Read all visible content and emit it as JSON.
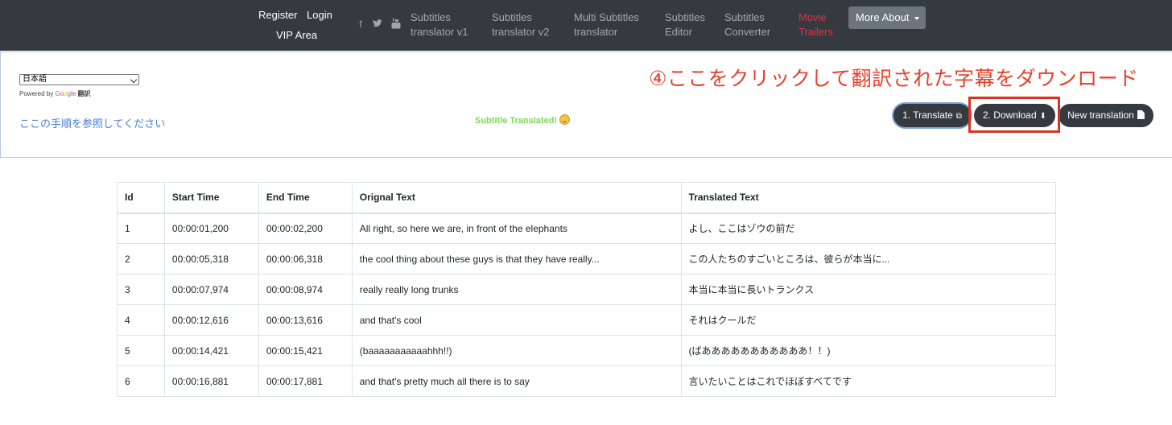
{
  "nav": {
    "register": "Register",
    "login": "Login",
    "vip": "VIP Area",
    "social": [
      "facebook-icon",
      "twitter-icon",
      "youtube-icon"
    ],
    "items": [
      {
        "line1": "Subtitles",
        "line2": "translator v1"
      },
      {
        "line1": "Subtitles",
        "line2": "translator v2"
      },
      {
        "line1": "Multi Subtitles",
        "line2": "translator"
      },
      {
        "line1": "Subtitles",
        "line2": "Editor"
      },
      {
        "line1": "Subtitles",
        "line2": "Converter"
      },
      {
        "line1": "Movie",
        "line2": "Trailers"
      }
    ],
    "more_about": "More About",
    "accent_red": "#dc3545"
  },
  "translate_widget": {
    "selected_language": "日本語",
    "powered_by": "Powered by",
    "google": [
      "G",
      "o",
      "o",
      "g",
      "l",
      "e"
    ],
    "translate_word": "翻訳"
  },
  "annotation": "④ここをクリックして翻訳された字幕をダウンロード",
  "help_link": "ここの手順を参照してください",
  "status": "Subtitle Translated!",
  "buttons": {
    "translate": "1. Translate",
    "download": "2. Download",
    "new_translation": "New translation"
  },
  "table": {
    "headers": [
      "Id",
      "Start Time",
      "End Time",
      "Orignal Text",
      "Translated Text"
    ],
    "rows": [
      [
        "1",
        "00:00:01,200",
        "00:00:02,200",
        "All right, so here we are, in front of the elephants",
        "よし、ここはゾウの前だ"
      ],
      [
        "2",
        "00:00:05,318",
        "00:00:06,318",
        "the cool thing about these guys is that they have really...",
        "この人たちのすごいところは、彼らが本当に..."
      ],
      [
        "3",
        "00:00:07,974",
        "00:00:08,974",
        "really really long trunks",
        "本当に本当に長いトランクス"
      ],
      [
        "4",
        "00:00:12,616",
        "00:00:13,616",
        "and that's cool",
        "それはクールだ"
      ],
      [
        "5",
        "00:00:14,421",
        "00:00:15,421",
        "(baaaaaaaaaaahhh!!)",
        "(ばあああああああああああ！！)"
      ],
      [
        "6",
        "00:00:16,881",
        "00:00:17,881",
        "and that's pretty much all there is to say",
        "言いたいことはこれでほぼすべてです"
      ]
    ]
  }
}
